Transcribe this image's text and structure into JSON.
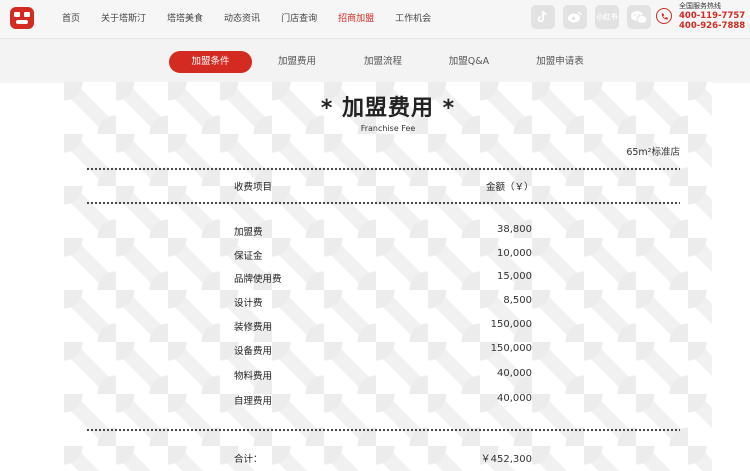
{
  "header": {
    "nav": [
      "首页",
      "关于塔斯汀",
      "塔塔美食",
      "动态资讯",
      "门店查询",
      "招商加盟",
      "工作机会"
    ],
    "active_nav": "招商加盟",
    "social_icons": [
      "douyin-icon",
      "weibo-icon",
      "xiaohongshu-icon",
      "wechat-icon"
    ],
    "xiaohongshu_text": "小红书",
    "hotline_label": "全国服务热线",
    "hotline_numbers": [
      "400-119-7757",
      "400-926-7888"
    ]
  },
  "subnav": {
    "tabs": [
      "加盟条件",
      "加盟费用",
      "加盟流程",
      "加盟Q&A",
      "加盟申请表"
    ],
    "active": "加盟条件"
  },
  "content": {
    "title": "* 加盟费用 *",
    "subtitle": "Franchise Fee",
    "store_type": "65m²标准店",
    "col_item": "收费项目",
    "col_amount": "金额（￥）",
    "rows": [
      {
        "item": "加盟费",
        "amount": "38,800"
      },
      {
        "item": "保证金",
        "amount": "10,000"
      },
      {
        "item": "品牌使用费",
        "amount": "15,000"
      },
      {
        "item": "设计费",
        "amount": "8,500"
      },
      {
        "item": "装修费用",
        "amount": "150,000"
      },
      {
        "item": "设备费用",
        "amount": "150,000"
      },
      {
        "item": "物料费用",
        "amount": "40,000"
      },
      {
        "item": "自理费用",
        "amount": "40,000"
      }
    ],
    "total_label": "合计：",
    "total_value": "￥452,300"
  },
  "colors": {
    "accent": "#d32b22",
    "background": "#f3f3f3"
  }
}
